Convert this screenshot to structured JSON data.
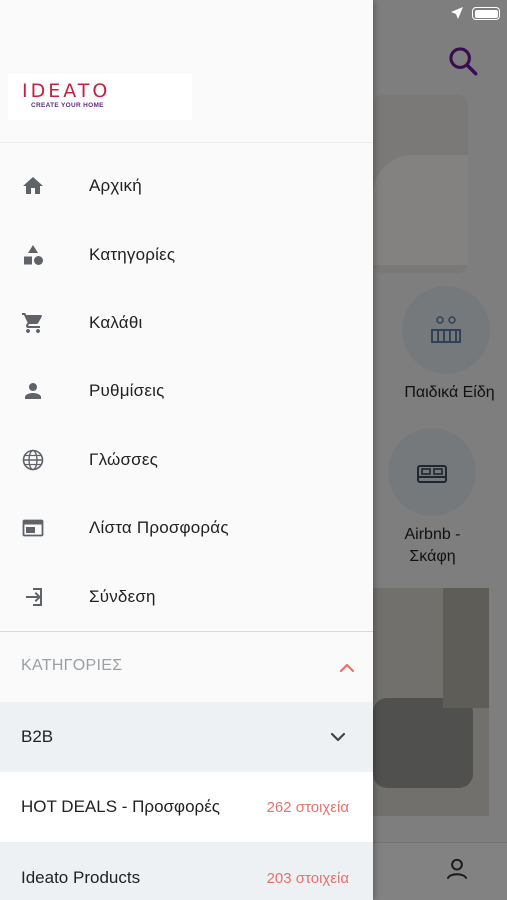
{
  "background": {
    "category_labels": [
      "Παιδικά Είδη",
      "Airbnb - Σκάφη"
    ]
  },
  "drawer": {
    "logo": {
      "text": "IDEATO",
      "tagline": "CREATE YOUR HOME"
    },
    "menu": [
      {
        "label": "Αρχική",
        "icon": "home-icon"
      },
      {
        "label": "Κατηγορίες",
        "icon": "shapes-icon"
      },
      {
        "label": "Καλάθι",
        "icon": "cart-icon"
      },
      {
        "label": "Ρυθμίσεις",
        "icon": "person-icon"
      },
      {
        "label": "Γλώσσες",
        "icon": "globe-icon"
      },
      {
        "label": "Λίστα Προσφοράς",
        "icon": "web-icon"
      },
      {
        "label": "Σύνδεση",
        "icon": "login-icon"
      }
    ],
    "categories_header": "ΚΑΤΗΓΟΡΙΕΣ",
    "categories": [
      {
        "name": "B2B",
        "count": ""
      },
      {
        "name": "HOT DEALS - Προσφορές",
        "count": "262 στοιχεία"
      },
      {
        "name": "Ideato Products",
        "count": "203 στοιχεία"
      }
    ]
  },
  "colors": {
    "accent": "#e8726a",
    "brand": "#c62145",
    "search": "#6a1b9a"
  }
}
